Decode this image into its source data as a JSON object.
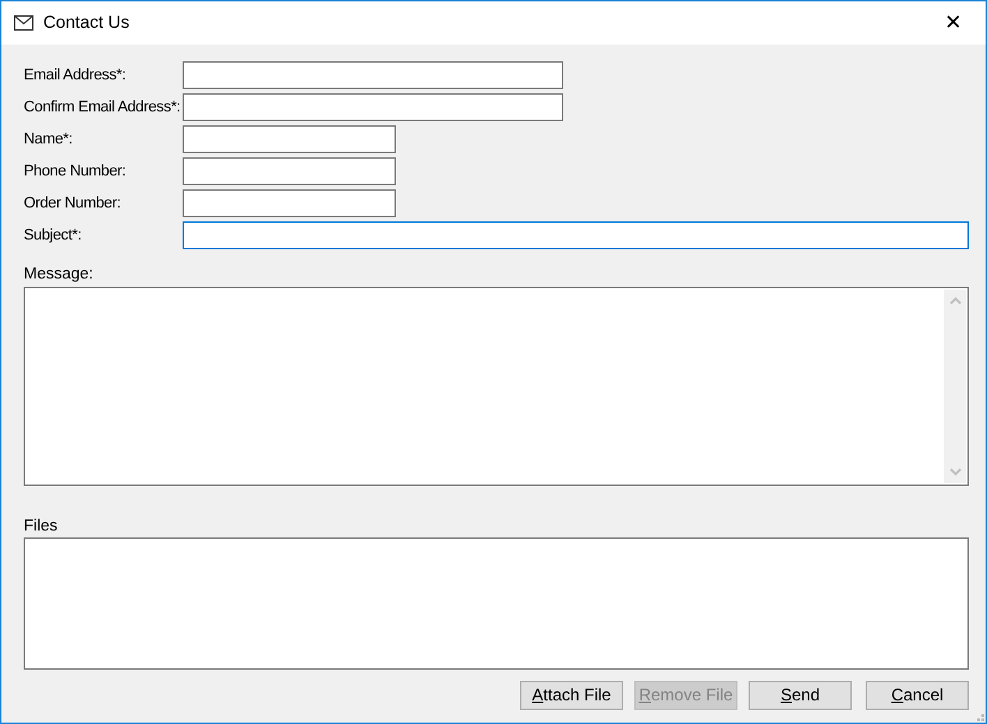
{
  "window": {
    "title": "Contact Us",
    "close": "✕"
  },
  "fields": [
    {
      "label": "Email Address*:",
      "kind": "wide",
      "focused": false
    },
    {
      "label": "Confirm Email Address*:",
      "kind": "wide",
      "focused": false
    },
    {
      "label": "Name*:",
      "kind": "short",
      "focused": false
    },
    {
      "label": "Phone Number:",
      "kind": "short",
      "focused": false
    },
    {
      "label": "Order Number:",
      "kind": "short",
      "focused": false
    },
    {
      "label": "Subject*:",
      "kind": "full",
      "focused": true
    }
  ],
  "message": {
    "label": "Message:"
  },
  "files": {
    "label": "Files"
  },
  "buttons": [
    {
      "key": "A",
      "rest": "ttach File",
      "disabled": false
    },
    {
      "key": "R",
      "rest": "emove File",
      "disabled": true
    },
    {
      "key": "S",
      "rest": "end",
      "disabled": false
    },
    {
      "key": "C",
      "rest": "ancel",
      "disabled": false
    }
  ]
}
